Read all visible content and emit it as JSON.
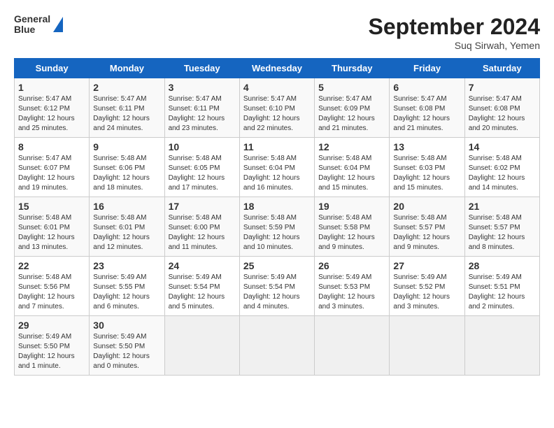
{
  "header": {
    "logo_line1": "General",
    "logo_line2": "Blue",
    "title": "September 2024",
    "subtitle": "Suq Sirwah, Yemen"
  },
  "days_of_week": [
    "Sunday",
    "Monday",
    "Tuesday",
    "Wednesday",
    "Thursday",
    "Friday",
    "Saturday"
  ],
  "weeks": [
    [
      {
        "day": 1,
        "info": "Sunrise: 5:47 AM\nSunset: 6:12 PM\nDaylight: 12 hours\nand 25 minutes."
      },
      {
        "day": 2,
        "info": "Sunrise: 5:47 AM\nSunset: 6:11 PM\nDaylight: 12 hours\nand 24 minutes."
      },
      {
        "day": 3,
        "info": "Sunrise: 5:47 AM\nSunset: 6:11 PM\nDaylight: 12 hours\nand 23 minutes."
      },
      {
        "day": 4,
        "info": "Sunrise: 5:47 AM\nSunset: 6:10 PM\nDaylight: 12 hours\nand 22 minutes."
      },
      {
        "day": 5,
        "info": "Sunrise: 5:47 AM\nSunset: 6:09 PM\nDaylight: 12 hours\nand 21 minutes."
      },
      {
        "day": 6,
        "info": "Sunrise: 5:47 AM\nSunset: 6:08 PM\nDaylight: 12 hours\nand 21 minutes."
      },
      {
        "day": 7,
        "info": "Sunrise: 5:47 AM\nSunset: 6:08 PM\nDaylight: 12 hours\nand 20 minutes."
      }
    ],
    [
      {
        "day": 8,
        "info": "Sunrise: 5:47 AM\nSunset: 6:07 PM\nDaylight: 12 hours\nand 19 minutes."
      },
      {
        "day": 9,
        "info": "Sunrise: 5:48 AM\nSunset: 6:06 PM\nDaylight: 12 hours\nand 18 minutes."
      },
      {
        "day": 10,
        "info": "Sunrise: 5:48 AM\nSunset: 6:05 PM\nDaylight: 12 hours\nand 17 minutes."
      },
      {
        "day": 11,
        "info": "Sunrise: 5:48 AM\nSunset: 6:04 PM\nDaylight: 12 hours\nand 16 minutes."
      },
      {
        "day": 12,
        "info": "Sunrise: 5:48 AM\nSunset: 6:04 PM\nDaylight: 12 hours\nand 15 minutes."
      },
      {
        "day": 13,
        "info": "Sunrise: 5:48 AM\nSunset: 6:03 PM\nDaylight: 12 hours\nand 15 minutes."
      },
      {
        "day": 14,
        "info": "Sunrise: 5:48 AM\nSunset: 6:02 PM\nDaylight: 12 hours\nand 14 minutes."
      }
    ],
    [
      {
        "day": 15,
        "info": "Sunrise: 5:48 AM\nSunset: 6:01 PM\nDaylight: 12 hours\nand 13 minutes."
      },
      {
        "day": 16,
        "info": "Sunrise: 5:48 AM\nSunset: 6:01 PM\nDaylight: 12 hours\nand 12 minutes."
      },
      {
        "day": 17,
        "info": "Sunrise: 5:48 AM\nSunset: 6:00 PM\nDaylight: 12 hours\nand 11 minutes."
      },
      {
        "day": 18,
        "info": "Sunrise: 5:48 AM\nSunset: 5:59 PM\nDaylight: 12 hours\nand 10 minutes."
      },
      {
        "day": 19,
        "info": "Sunrise: 5:48 AM\nSunset: 5:58 PM\nDaylight: 12 hours\nand 9 minutes."
      },
      {
        "day": 20,
        "info": "Sunrise: 5:48 AM\nSunset: 5:57 PM\nDaylight: 12 hours\nand 9 minutes."
      },
      {
        "day": 21,
        "info": "Sunrise: 5:48 AM\nSunset: 5:57 PM\nDaylight: 12 hours\nand 8 minutes."
      }
    ],
    [
      {
        "day": 22,
        "info": "Sunrise: 5:48 AM\nSunset: 5:56 PM\nDaylight: 12 hours\nand 7 minutes."
      },
      {
        "day": 23,
        "info": "Sunrise: 5:49 AM\nSunset: 5:55 PM\nDaylight: 12 hours\nand 6 minutes."
      },
      {
        "day": 24,
        "info": "Sunrise: 5:49 AM\nSunset: 5:54 PM\nDaylight: 12 hours\nand 5 minutes."
      },
      {
        "day": 25,
        "info": "Sunrise: 5:49 AM\nSunset: 5:54 PM\nDaylight: 12 hours\nand 4 minutes."
      },
      {
        "day": 26,
        "info": "Sunrise: 5:49 AM\nSunset: 5:53 PM\nDaylight: 12 hours\nand 3 minutes."
      },
      {
        "day": 27,
        "info": "Sunrise: 5:49 AM\nSunset: 5:52 PM\nDaylight: 12 hours\nand 3 minutes."
      },
      {
        "day": 28,
        "info": "Sunrise: 5:49 AM\nSunset: 5:51 PM\nDaylight: 12 hours\nand 2 minutes."
      }
    ],
    [
      {
        "day": 29,
        "info": "Sunrise: 5:49 AM\nSunset: 5:50 PM\nDaylight: 12 hours\nand 1 minute."
      },
      {
        "day": 30,
        "info": "Sunrise: 5:49 AM\nSunset: 5:50 PM\nDaylight: 12 hours\nand 0 minutes."
      },
      {
        "day": null,
        "info": ""
      },
      {
        "day": null,
        "info": ""
      },
      {
        "day": null,
        "info": ""
      },
      {
        "day": null,
        "info": ""
      },
      {
        "day": null,
        "info": ""
      }
    ]
  ]
}
